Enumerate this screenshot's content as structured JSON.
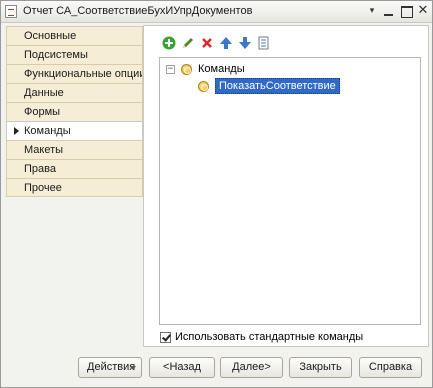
{
  "window": {
    "title": "Отчет СА_СоответствиеБухИУпрДокументов",
    "more_glyph": "▾"
  },
  "tabs": [
    {
      "label": "Основные",
      "active": false
    },
    {
      "label": "Подсистемы",
      "active": false
    },
    {
      "label": "Функциональные опции",
      "active": false
    },
    {
      "label": "Данные",
      "active": false
    },
    {
      "label": "Формы",
      "active": false
    },
    {
      "label": "Команды",
      "active": true
    },
    {
      "label": "Макеты",
      "active": false
    },
    {
      "label": "Права",
      "active": false
    },
    {
      "label": "Прочее",
      "active": false
    }
  ],
  "toolbar": {
    "icons": [
      "add-icon",
      "edit-icon",
      "delete-icon",
      "move-up-icon",
      "move-down-icon",
      "sort-icon"
    ],
    "colors": {
      "add": "#3aa336",
      "edit": "#4b8a2e",
      "delete": "#d9262c",
      "arrows": "#3c78c8"
    }
  },
  "tree": {
    "root": {
      "label": "Команды",
      "expanded": true,
      "expander": "−"
    },
    "children": [
      {
        "label": "ПоказатьСоответствие",
        "selected": true
      }
    ]
  },
  "options": {
    "use_standard_commands_label": "Использовать стандартные команды",
    "use_standard_commands_checked": true
  },
  "buttons": {
    "actions": "Действия",
    "back": "<Назад",
    "next": "Далее>",
    "close": "Закрыть",
    "help": "Справка"
  },
  "colors": {
    "tab_bg": "#f5edd6",
    "selection": "#3169c6"
  }
}
